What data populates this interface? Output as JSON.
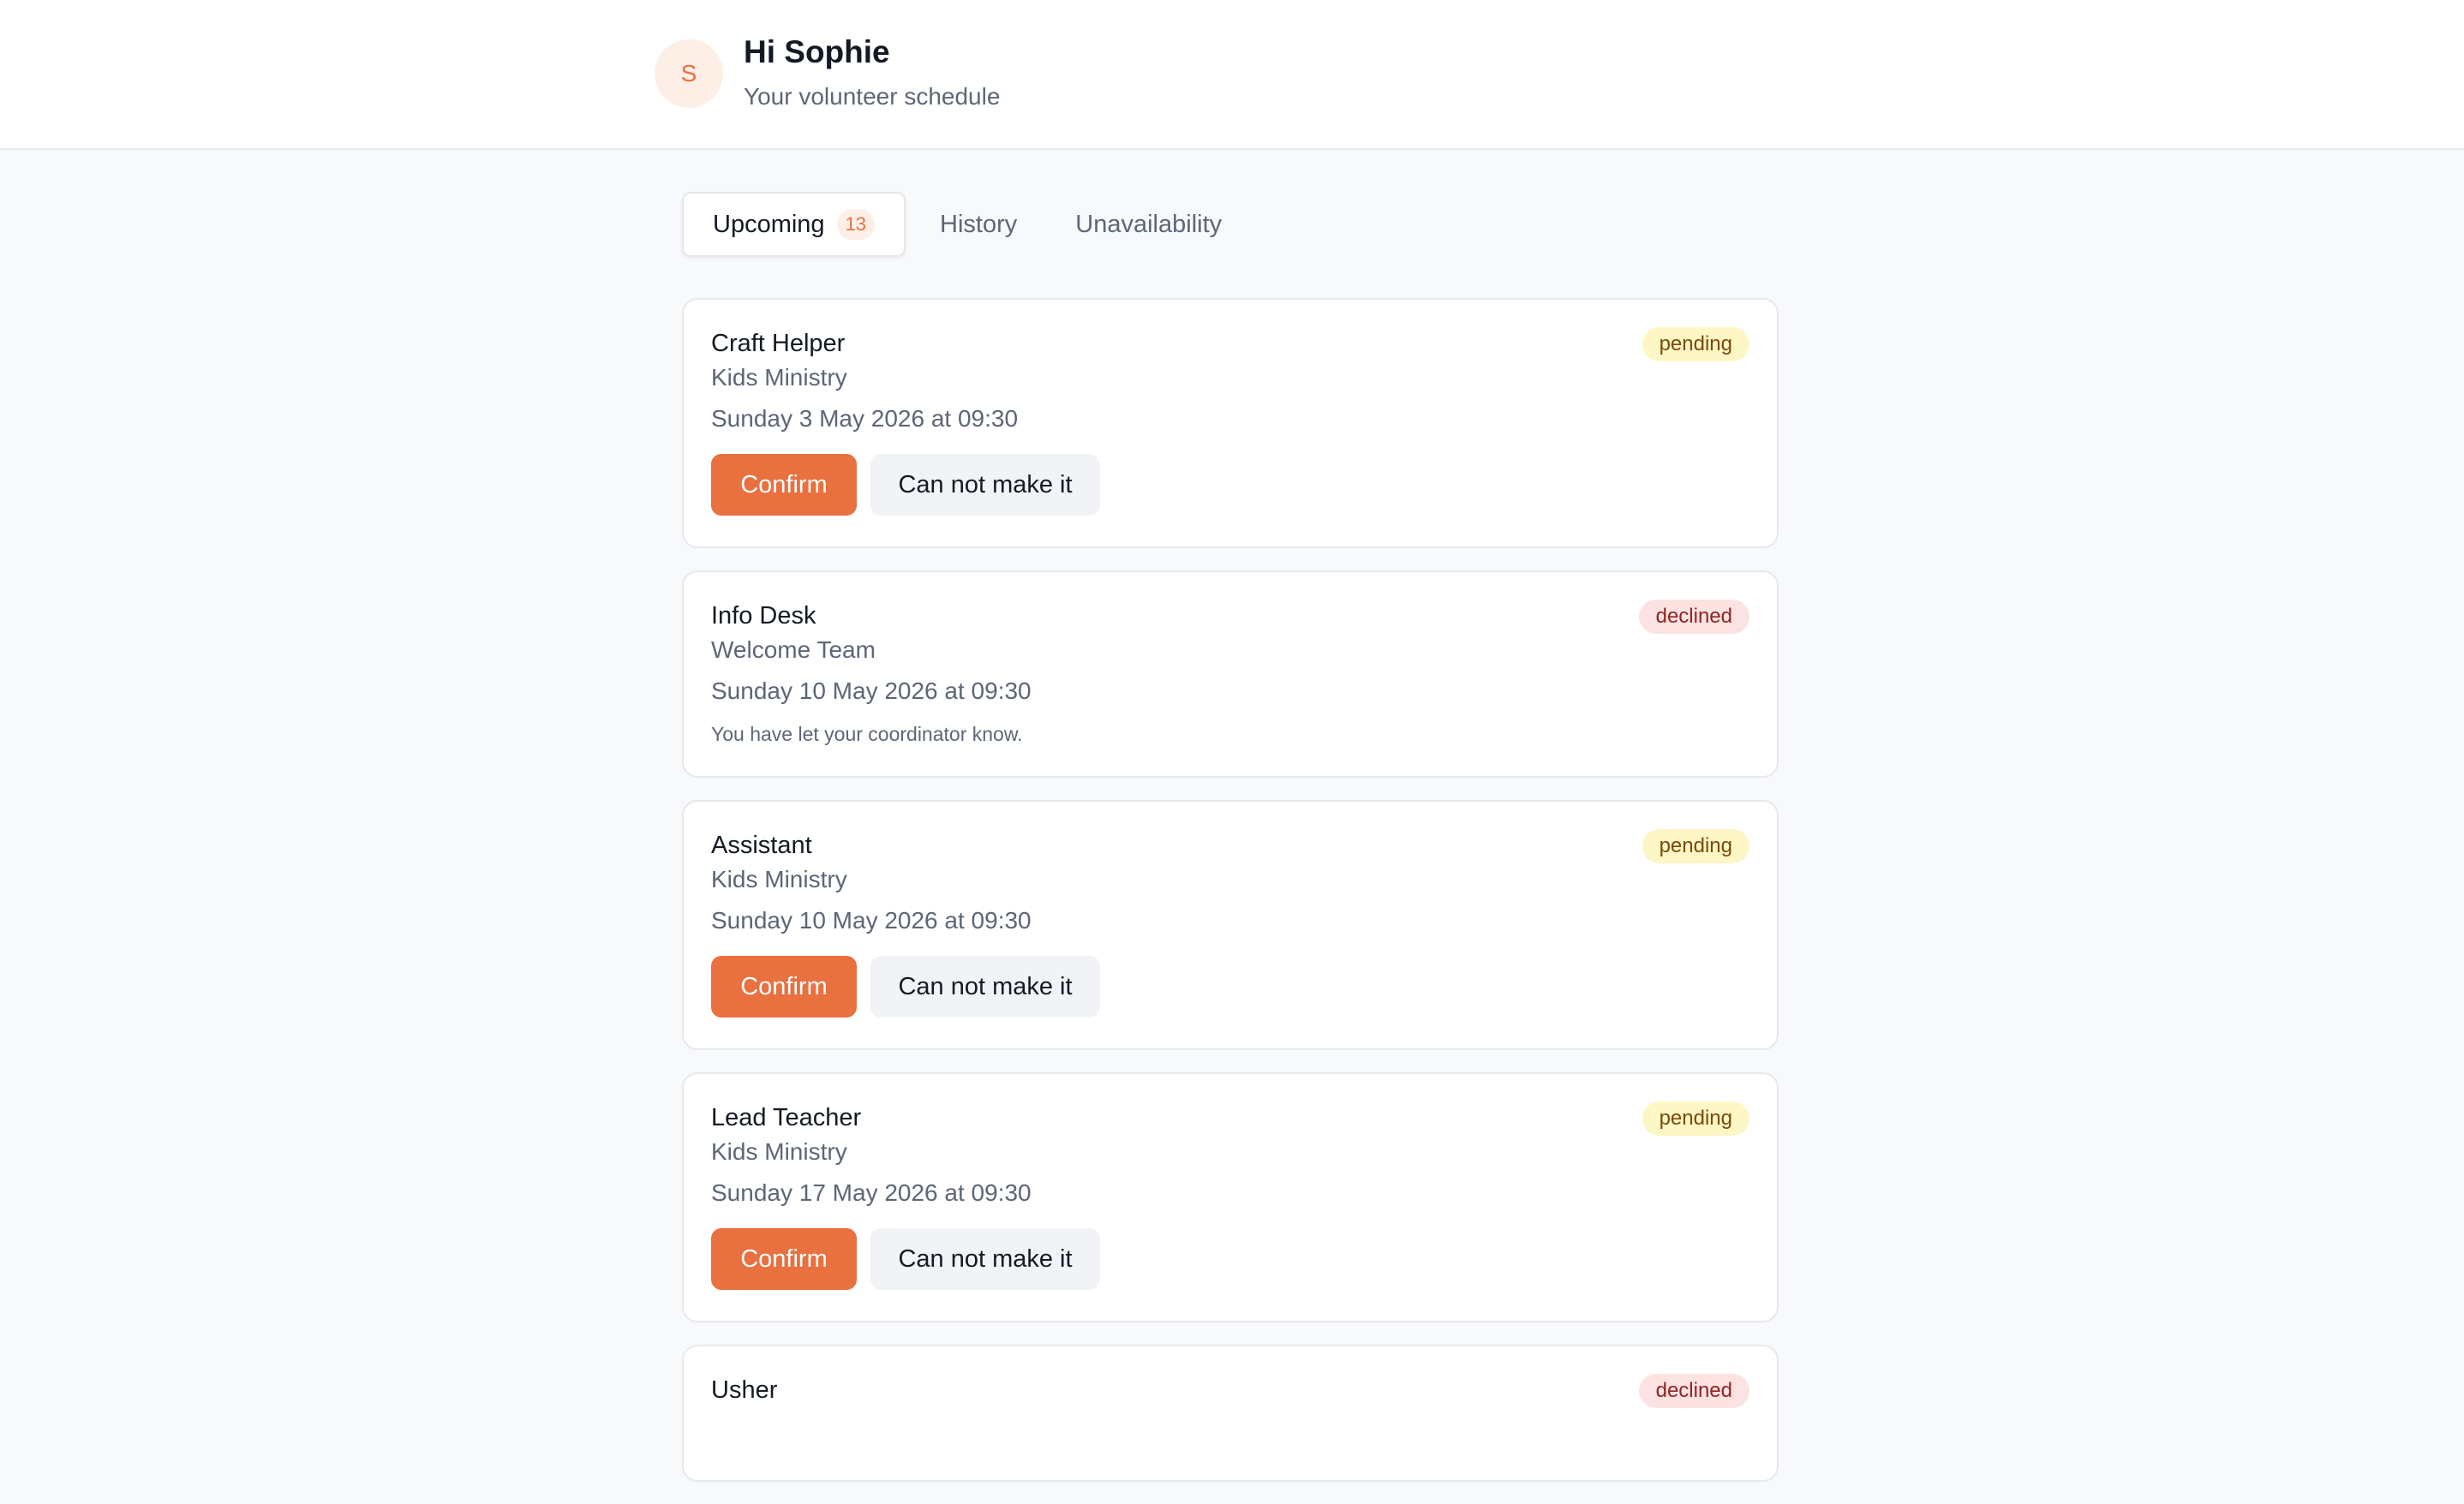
{
  "header": {
    "avatar_initial": "S",
    "greeting": "Hi Sophie",
    "subtitle": "Your volunteer schedule"
  },
  "tabs": [
    {
      "label": "Upcoming",
      "count": "13",
      "active": true
    },
    {
      "label": "History",
      "active": false
    },
    {
      "label": "Unavailability",
      "active": false
    }
  ],
  "actions": {
    "confirm_label": "Confirm",
    "decline_label": "Can not make it"
  },
  "assignments": [
    {
      "role": "Craft Helper",
      "team": "Kids Ministry",
      "when": "Sunday 3 May 2026 at 09:30",
      "status": "pending"
    },
    {
      "role": "Info Desk",
      "team": "Welcome Team",
      "when": "Sunday 10 May 2026 at 09:30",
      "status": "declined",
      "note": "You have let your coordinator know."
    },
    {
      "role": "Assistant",
      "team": "Kids Ministry",
      "when": "Sunday 10 May 2026 at 09:30",
      "status": "pending"
    },
    {
      "role": "Lead Teacher",
      "team": "Kids Ministry",
      "when": "Sunday 17 May 2026 at 09:30",
      "status": "pending"
    },
    {
      "role": "Usher",
      "status": "declined"
    }
  ],
  "colors": {
    "accent": "#e9703f",
    "pending_bg": "#fef6c5",
    "declined_bg": "#fde2e2"
  }
}
